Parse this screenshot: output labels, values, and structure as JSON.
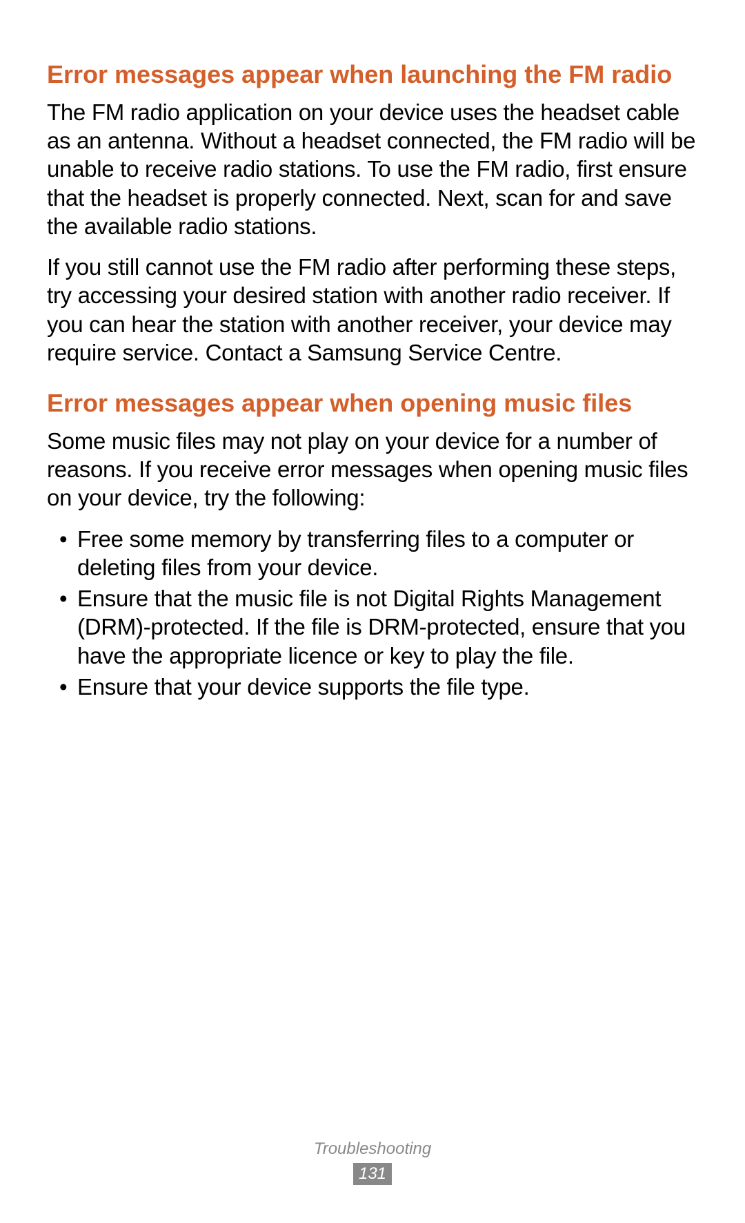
{
  "sections": [
    {
      "heading": "Error messages appear when launching the FM radio",
      "paragraphs": [
        "The FM radio application on your device uses the headset cable as an antenna. Without a headset connected, the FM radio will be unable to receive radio stations. To use the FM radio, first ensure that the headset is properly connected. Next, scan for and save the available radio stations.",
        "If you still cannot use the FM radio after performing these steps, try accessing your desired station with another radio receiver. If you can hear the station with another receiver, your device may require service. Contact a Samsung Service Centre."
      ]
    },
    {
      "heading": "Error messages appear when opening music files",
      "paragraphs": [
        "Some music files may not play on your device for a number of reasons. If you receive error messages when opening music files on your device, try the following:"
      ],
      "bullets": [
        "Free some memory by transferring files to a computer or deleting files from your device.",
        "Ensure that the music file is not Digital Rights Management (DRM)-protected. If the file is DRM-protected, ensure that you have the appropriate licence or key to play the file.",
        "Ensure that your device supports the file type."
      ]
    }
  ],
  "footer": {
    "label": "Troubleshooting",
    "page": "131"
  }
}
